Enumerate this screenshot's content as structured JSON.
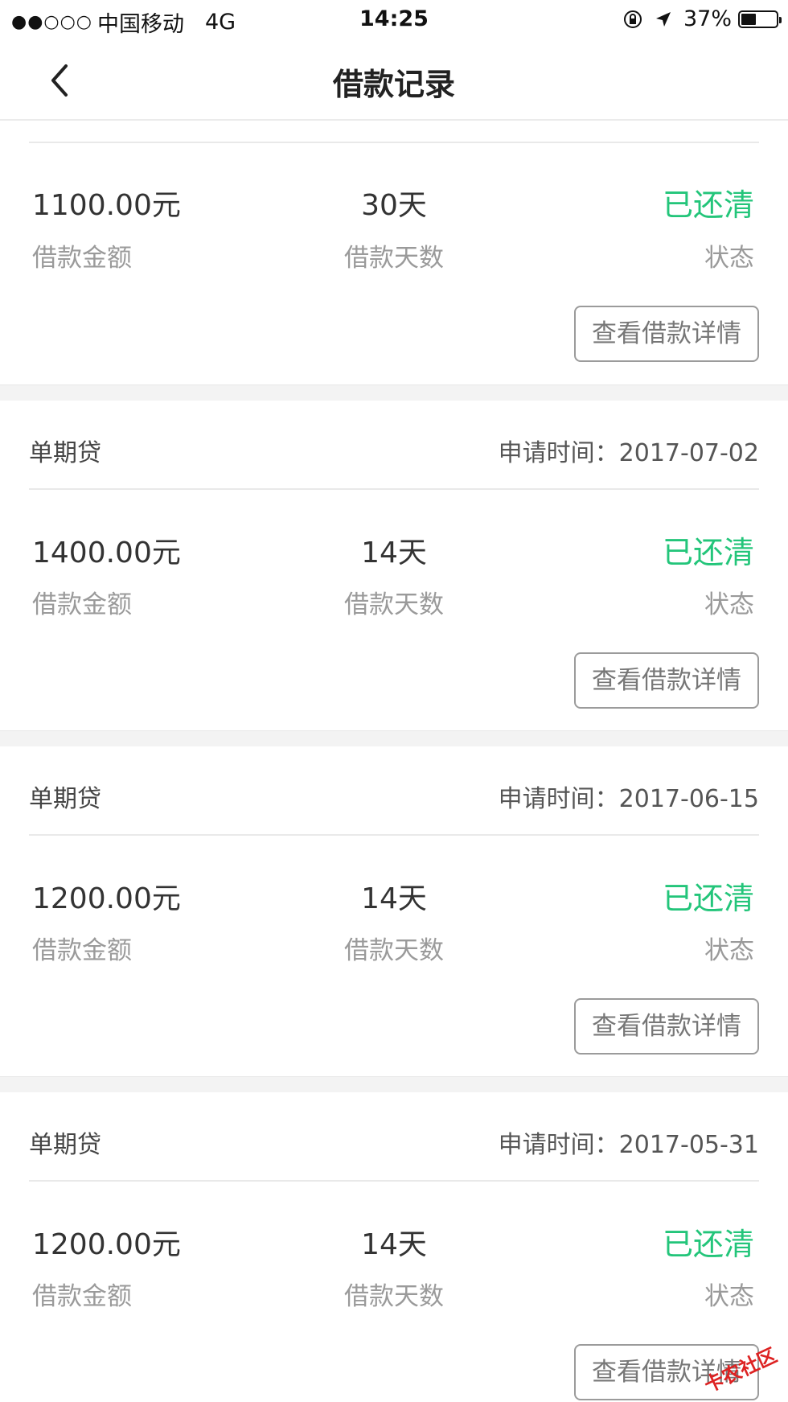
{
  "status_bar": {
    "signal": "●●○○○",
    "carrier": "中国移动",
    "network": "4G",
    "time": "14:25",
    "battery": "37%"
  },
  "nav": {
    "title": "借款记录"
  },
  "labels": {
    "amount": "借款金额",
    "days": "借款天数",
    "status": "状态",
    "detail_button": "查看借款详情"
  },
  "records": [
    {
      "amount": "1100.00元",
      "days": "30天",
      "status": "已还清"
    },
    {
      "type": "单期贷",
      "apply_time": "申请时间：2017-07-02",
      "amount": "1400.00元",
      "days": "14天",
      "status": "已还清"
    },
    {
      "type": "单期贷",
      "apply_time": "申请时间：2017-06-15",
      "amount": "1200.00元",
      "days": "14天",
      "status": "已还清"
    },
    {
      "type": "单期贷",
      "apply_time": "申请时间：2017-05-31",
      "amount": "1200.00元",
      "days": "14天",
      "status": "已还清"
    }
  ],
  "watermark": "卡农社区",
  "colors": {
    "status_green": "#23c57a",
    "gap_gray": "#f3f3f3"
  }
}
